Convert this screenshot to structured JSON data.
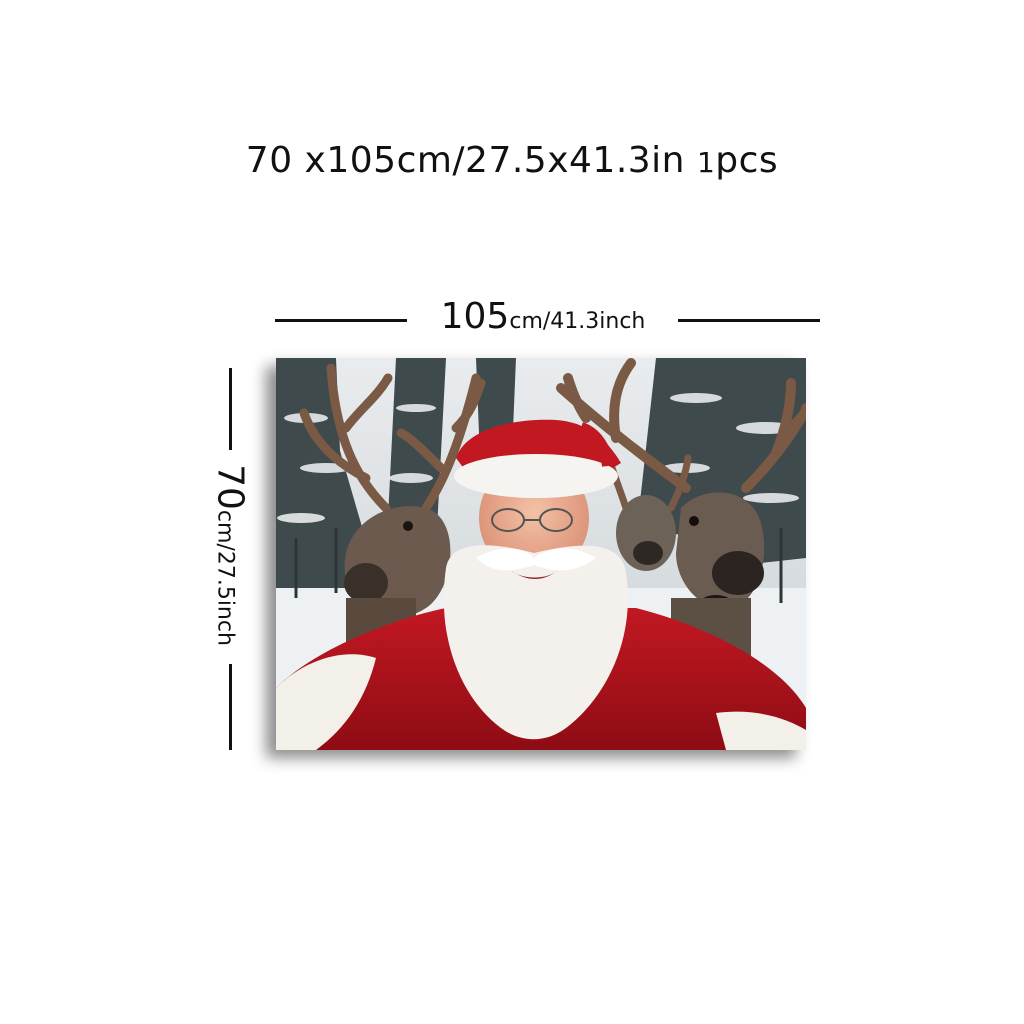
{
  "header": {
    "size_text": "70 x105cm/27.5x41.3in",
    "qty_num": "1",
    "qty_unit": "pcs"
  },
  "width_dim": {
    "value": "105",
    "unit": "cm/41.3inch"
  },
  "height_dim": {
    "value": "70",
    "unit": "cm/27.5inch"
  },
  "colors": {
    "santa_red": "#b5121b",
    "beard": "#f4f1ec",
    "antler": "#7a5a44",
    "snow": "#eef1f3"
  }
}
